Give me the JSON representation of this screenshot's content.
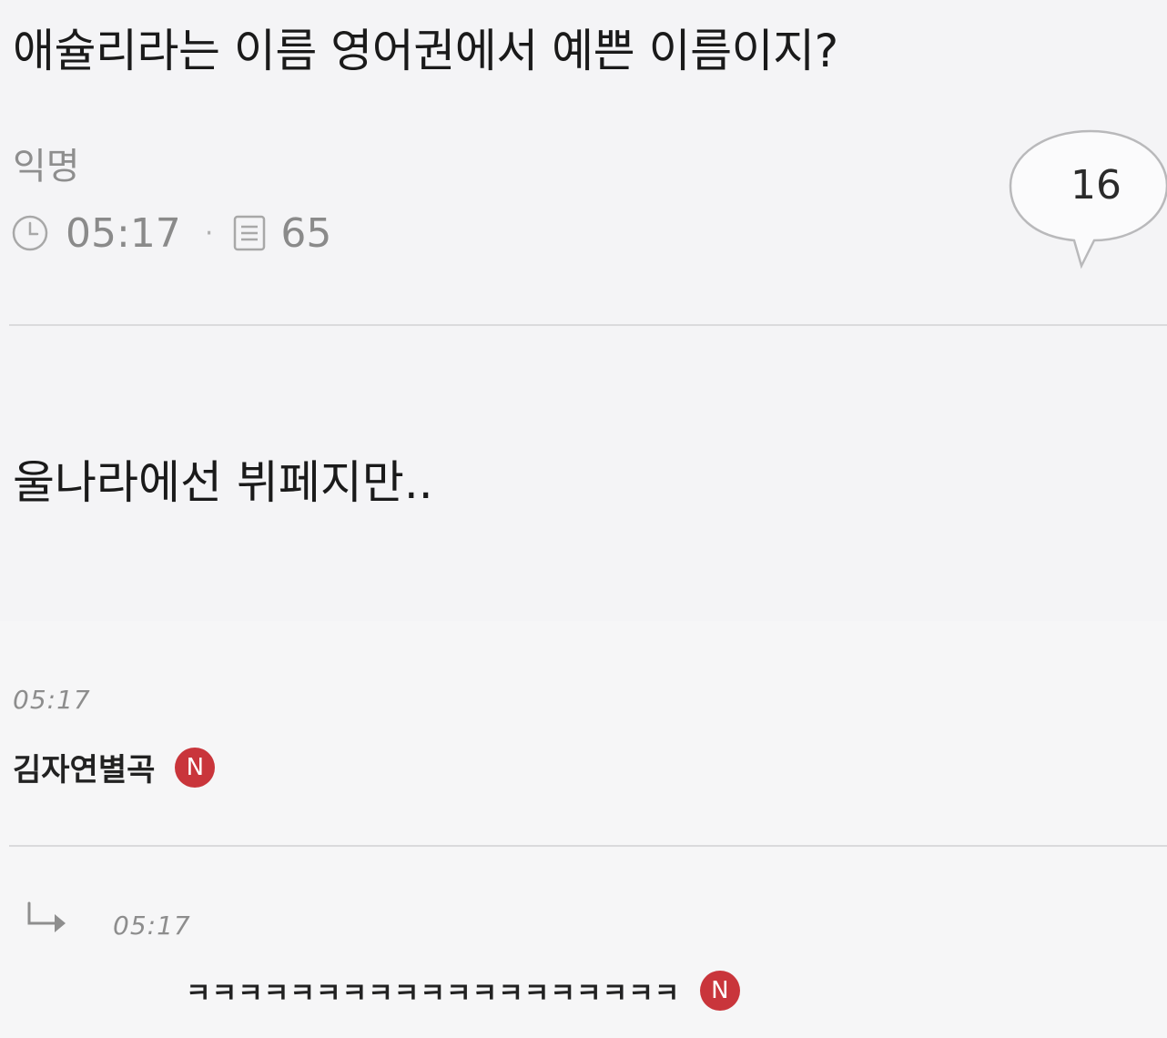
{
  "post": {
    "title": "애슐리라는 이름 영어권에서 예쁜 이름이지?",
    "author": "익명",
    "time": "05:17",
    "meta_separator": "·",
    "views": "65",
    "comment_count": "16",
    "body": "울나라에선 뷔페지만.."
  },
  "comments": [
    {
      "time": "05:17",
      "username": "김자연별곡",
      "badge": "N"
    }
  ],
  "replies": [
    {
      "time": "05:17",
      "text": "ㅋㅋㅋㅋㅋㅋㅋㅋㅋㅋㅋㅋㅋㅋㅋㅋㅋㅋㅋ",
      "badge": "N"
    }
  ],
  "colors": {
    "background": "#f4f4f6",
    "badge": "#c9353b",
    "muted_text": "#8a8a8a",
    "divider": "#dadadc"
  },
  "icons": {
    "time": "clock-icon",
    "views": "document-icon",
    "comments": "speech-bubble-icon",
    "reply": "reply-arrow-icon"
  }
}
